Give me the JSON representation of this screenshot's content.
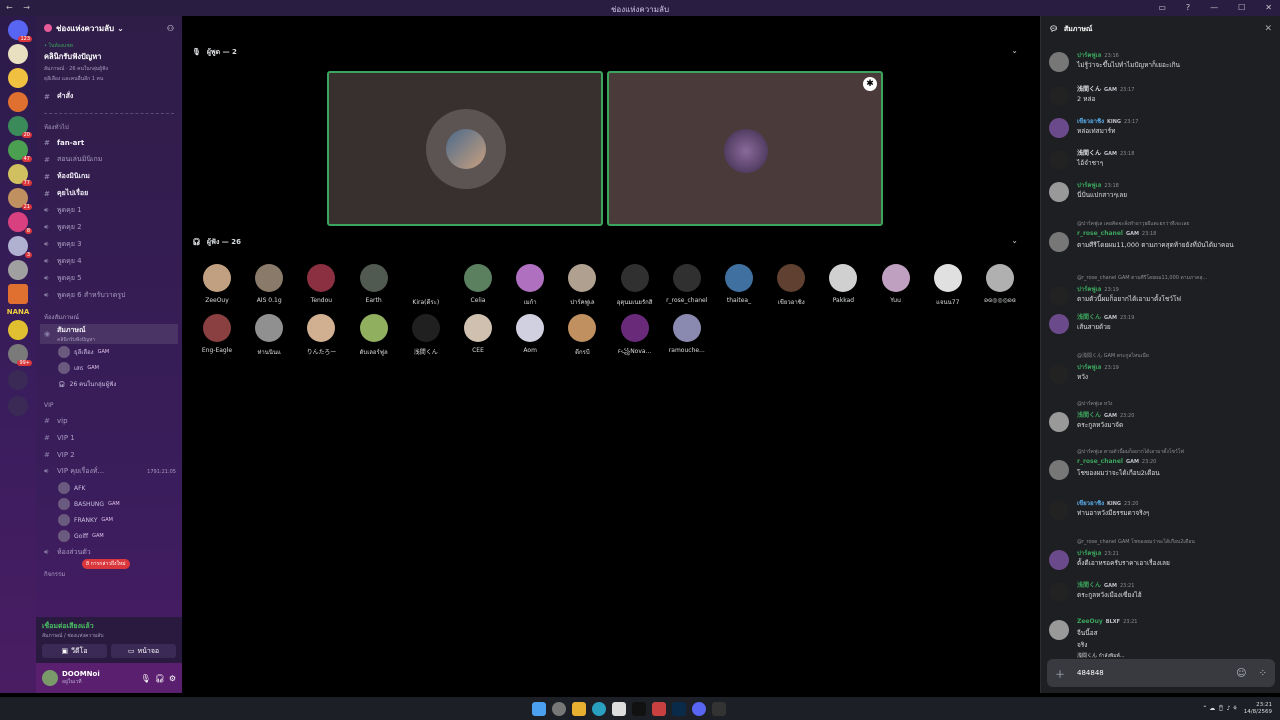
{
  "window": {
    "title": "ช่องแห่งความลับ",
    "nav": "← →"
  },
  "rail": {
    "servers": [
      {
        "color": "#5865f2",
        "badge": "123"
      },
      {
        "color": "#e8e0c0",
        "badge": ""
      },
      {
        "color": "#f0c040",
        "badge": ""
      },
      {
        "color": "#e07030",
        "badge": ""
      },
      {
        "color": "#3a8a5a",
        "badge": "20"
      },
      {
        "color": "#4aa050",
        "badge": "47"
      },
      {
        "color": "#d0c060",
        "badge": "77"
      },
      {
        "color": "#c09060",
        "badge": "21"
      },
      {
        "color": "#d84080",
        "badge": "8"
      },
      {
        "color": "#b0b0d0",
        "badge": "3"
      },
      {
        "color": "#a0a0a0",
        "badge": ""
      },
      {
        "color": "#e07030",
        "badge": ""
      },
      {
        "color": "#e0c030",
        "badge": ""
      },
      {
        "color": "#7a7a7a",
        "badge": "99+"
      }
    ],
    "nana": "NANA"
  },
  "sidebar": {
    "server_name": "ช่องแห่งความลับ",
    "event": {
      "tag": "• ในห้องแชท",
      "title": "คลินิกรับฟังปัญหา",
      "line1": "สัมภาษณ์ · 26 คนในกลุ่มผู้ฟัง",
      "line2": "ธุลีเลือง และคนอื่นอีก 1 คน"
    },
    "cmd": "คำสั่ง",
    "cat_general": "ห้องทั่วไป",
    "text_channels": [
      {
        "name": "fan-art",
        "bold": true
      },
      {
        "name": "สอนเล่นมินิเกม",
        "bold": false
      },
      {
        "name": "ห้องมินิเกม",
        "bold": true
      },
      {
        "name": "คุยไปเรื่อย",
        "bold": true
      }
    ],
    "voice_channels": [
      "พูดคุย 1",
      "พูดคุย 2",
      "พูดคุย 3",
      "พูดคุย 4",
      "พูดคุย 5",
      "พูดคุย 6 สำหรับวาดรูป"
    ],
    "cat_interview": "ห้องสัมภาษณ์",
    "stage": {
      "name": "สัมภาษณ์",
      "sub": "คลินิกรับฟังปัญหา"
    },
    "stage_users": [
      {
        "name": "ธุลีเลือง",
        "tag": "GAM"
      },
      {
        "name": "เสธ",
        "tag": "GAM"
      }
    ],
    "stage_listeners": "26 คนในกลุ่มผู้ฟัง",
    "cat_vip": "VIP",
    "vip_channels": [
      "vip",
      "VIP 1",
      "VIP 2"
    ],
    "vip_voice": {
      "name": "VIP คุยเรื่องทั่...",
      "timer": "1791:21:05"
    },
    "vip_users": [
      {
        "name": "AFK",
        "tag": ""
      },
      {
        "name": "BASHUNG",
        "tag": "GAM"
      },
      {
        "name": "FRANKY",
        "tag": "GAM"
      },
      {
        "name": "Golff",
        "tag": "GAM"
      }
    ],
    "private": "ห้องส่วนตัว",
    "cat_bottom": "กิจกรรม",
    "mentions": "8 การกล่าวถึงใหม่",
    "voice_status": {
      "connected": "เชื่อมต่อเสียงแล้ว",
      "location": "สัมภาษณ์ / ช่องแห่งความลับ",
      "video": "วีดีโอ",
      "screen": "หน้าจอ"
    },
    "user": {
      "name": "DOOMNoi",
      "status": "อยู่ในเวที"
    }
  },
  "stage": {
    "speakers_label": "ผู้พูด — 2",
    "listeners_label": "ผู้ฟัง — 26",
    "listeners": [
      {
        "name": "ZeeOuy",
        "color": "#c0a080"
      },
      {
        "name": "AIS 0.1g",
        "color": "#8a7a6a"
      },
      {
        "name": "Tendou",
        "color": "#8a3040"
      },
      {
        "name": "Earth",
        "color": "#505a50"
      },
      {
        "name": "Kira(ดีระ)",
        "color": "#000000"
      },
      {
        "name": "Celia",
        "color": "#5a8060"
      },
      {
        "name": "เมก้า",
        "color": "#b070c0"
      },
      {
        "name": "ปาร์คฟูเล",
        "color": "#b0a090"
      },
      {
        "name": "อุตุนมเนยรักสิ",
        "color": "#303030"
      },
      {
        "name": "r_rose_chanel",
        "color": "#303030"
      },
      {
        "name": "thaitea_",
        "color": "#4070a0"
      },
      {
        "name": "เขียวอาชิง",
        "color": "#604030"
      },
      {
        "name": "Pakkad",
        "color": "#d0d0d0"
      },
      {
        "name": "Yuu",
        "color": "#c0a0c0"
      },
      {
        "name": "แจนน77",
        "color": "#e0e0e0"
      },
      {
        "name": "ʚɞ◎◎◎ʚɞ",
        "color": "#b0b0b0"
      },
      {
        "name": "Eng-Eagle",
        "color": "#8a4040"
      },
      {
        "name": "ท่านนินแ",
        "color": "#909090"
      },
      {
        "name": "りんたろー",
        "color": "#d0b090"
      },
      {
        "name": "ดับเลอร์ฟูล",
        "color": "#90b060"
      },
      {
        "name": "浅間くん",
        "color": "#202020"
      },
      {
        "name": "CEE",
        "color": "#d0c0b0"
      },
      {
        "name": "Aom",
        "color": "#d0d0e0"
      },
      {
        "name": "ดีกรบี",
        "color": "#c09060"
      },
      {
        "name": "ꜰ꧁Nova...",
        "color": "#6a2a7a"
      },
      {
        "name": "ramouche...",
        "color": "#8a8ab0"
      }
    ]
  },
  "chat": {
    "title": "สัมภาษณ์",
    "input_value": "484848",
    "typing": "浅間くん กำลังพิมพ์...",
    "messages": [
      {
        "who": "ปาร์คฟูเล",
        "color": "#3ba55d",
        "time": "23:16",
        "tag": "",
        "text": "ไม่รู้ว่าจะขึ้นไปทำไมปัญหาก็เยอะเกิน",
        "reply": ""
      },
      {
        "who": "浅間くん",
        "color": "#dbdee1",
        "time": "23:17",
        "tag": "GAM",
        "text": "2 หล่อ",
        "reply": ""
      },
      {
        "who": "เขียวอาชิง",
        "color": "#5ab0f0",
        "time": "23:17",
        "tag": "KING",
        "text": "หล่อเท่สมาร์ท",
        "reply": ""
      },
      {
        "who": "浅間くん",
        "color": "#dbdee1",
        "time": "23:18",
        "tag": "GAM",
        "text": "ไอ้จำชาๆ",
        "reply": ""
      },
      {
        "who": "ปาร์คฟูเล",
        "color": "#3ba55d",
        "time": "23:18",
        "tag": "",
        "text": "นี่ปั่นแปกสาวๆเลย",
        "reply": ""
      },
      {
        "who": "r_rose_chanel",
        "color": "#3ba55d",
        "time": "23:18",
        "tag": "GAM",
        "text": "ตามศีรีโดยผม11,000 ตามภาคสุดท้ายยังที่มันได้มาคอน",
        "reply": "@ปาร์คฟูเล เคยคิดจะลั่งทำอาวุธผีแตะยกว่าทีเจะเลย"
      },
      {
        "who": "ปาร์คฟูเล",
        "color": "#3ba55d",
        "time": "23:19",
        "tag": "",
        "text": "ตามตัวนี้ผมก็อยากได้เอามาตั้งโชว์โฟ",
        "reply": "@r_rose_chanel GAM ตามศีรีโดยผม11,000 ตามภาคสุ..."
      },
      {
        "who": "浅間くん",
        "color": "#3ba55d",
        "time": "23:19",
        "tag": "GAM",
        "text": "เส้นสายด้วย",
        "reply": ""
      },
      {
        "who": "ปาร์คฟูเล",
        "color": "#3ba55d",
        "time": "23:19",
        "tag": "",
        "text": "หวัง",
        "reply": "@浅間くん GAM ตระกูลไหนเนี่ย"
      },
      {
        "who": "浅間くん",
        "color": "#3ba55d",
        "time": "23:20",
        "tag": "GAM",
        "text": "ตระกูลหวังมาจัด",
        "reply": "@ปาร์คฟูเล หวัง"
      },
      {
        "who": "r_rose_chanel",
        "color": "#3ba55d",
        "time": "23:20",
        "tag": "GAM",
        "text": "โชของผมว่าจะได้เกือบ2เดือน",
        "reply": "@ปาร์คฟูเล ตามตัวนี้ผมก็อยากได้เอามาตั้งโชว์โฟ"
      },
      {
        "who": "เขียวอาชิง",
        "color": "#5ab0f0",
        "time": "23:20",
        "tag": "KING",
        "text": "ท่านอาหวังมีธรรมดาจริงๆ",
        "reply": ""
      },
      {
        "who": "ปาร์คฟูเล",
        "color": "#3ba55d",
        "time": "23:21",
        "tag": "",
        "text": "ตั้งตีเอาหรอครับราคาเอาเรื่องเลย",
        "reply": "@r_rose_chanel GAM โชของผมว่าจะได้เกือบ2เดือน"
      },
      {
        "who": "浅間くん",
        "color": "#3ba55d",
        "time": "23:21",
        "tag": "GAM",
        "text": "ตระกูลหวังเมืองเซี่ยงไฮ้",
        "reply": ""
      },
      {
        "who": "ZeeOuy",
        "color": "#3ba55d",
        "time": "23:21",
        "tag": "BLXF",
        "text": "จีนนี้อส",
        "reply": ""
      }
    ],
    "extra_line": "จริง"
  },
  "taskbar": {
    "time": "23:21",
    "date": "14/8/2569"
  }
}
